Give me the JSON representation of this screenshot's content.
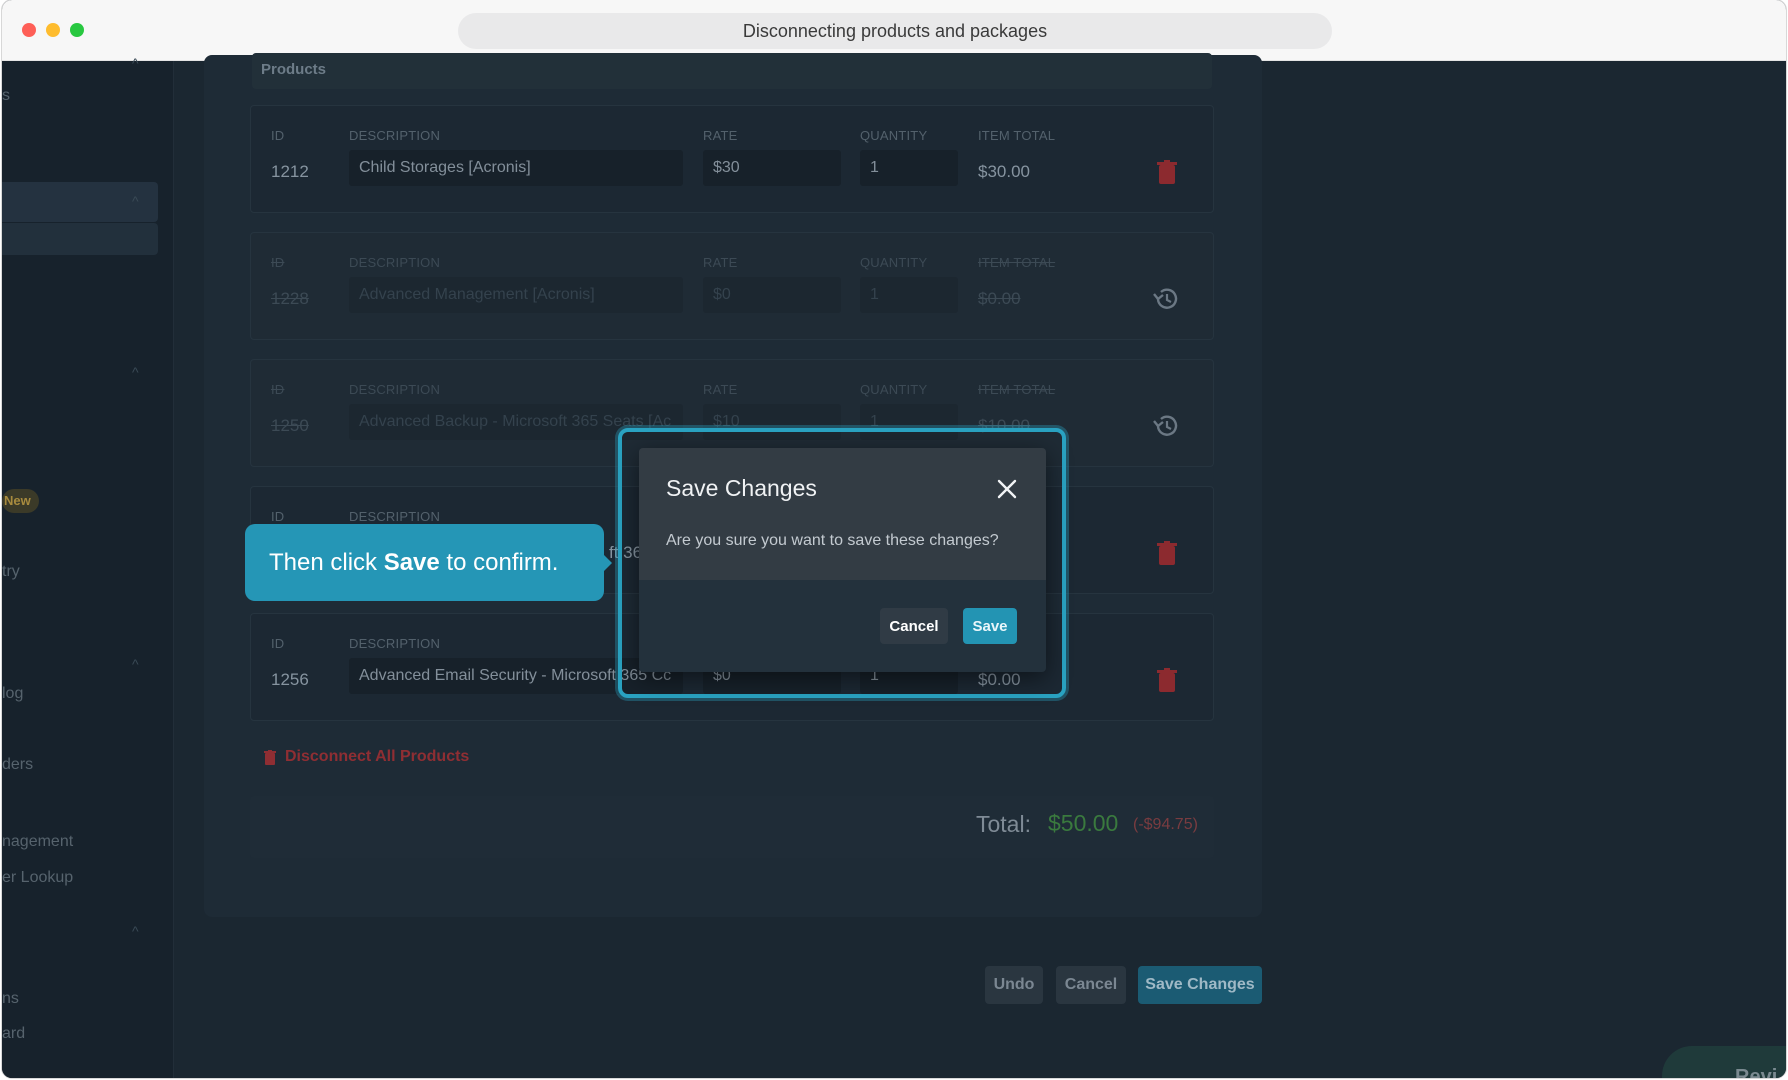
{
  "window": {
    "title": "Disconnecting products and packages"
  },
  "sidebar": {
    "fragments": [
      "s",
      "New",
      "try",
      "log",
      "ders",
      "nagement",
      "er Lookup",
      "ns",
      "ard"
    ]
  },
  "products": {
    "section_title": "Products",
    "columns": {
      "id": "ID",
      "description": "DESCRIPTION",
      "rate": "RATE",
      "quantity": "QUANTITY",
      "item_total": "ITEM TOTAL"
    },
    "rows": [
      {
        "id": "1212",
        "description": "Child Storages [Acronis]",
        "rate": "$30",
        "quantity": "1",
        "item_total": "$30.00",
        "status": "active"
      },
      {
        "id": "1228",
        "description": "Advanced Management [Acronis]",
        "rate": "$0",
        "quantity": "1",
        "item_total": "$0.00",
        "status": "removed"
      },
      {
        "id": "1250",
        "description": "Advanced Backup - Microsoft 365 Seats [Ac",
        "rate": "$10",
        "quantity": "1",
        "item_total": "$10.00",
        "status": "removed"
      },
      {
        "id": "",
        "description": "ft 36",
        "rate": "",
        "quantity": "",
        "item_total": "",
        "status": "active"
      },
      {
        "id": "1256",
        "description": "Advanced Email Security - Microsoft 365 Cc",
        "rate": "$0",
        "quantity": "1",
        "item_total": "$0.00",
        "status": "active"
      }
    ],
    "disconnect_all_label": "Disconnect All Products"
  },
  "totals": {
    "label": "Total:",
    "value": "$50.00",
    "delta": "(-$94.75)"
  },
  "actions": {
    "undo": "Undo",
    "cancel": "Cancel",
    "save_changes": "Save Changes"
  },
  "modal": {
    "title": "Save Changes",
    "message": "Are you sure you want to save these changes?",
    "cancel": "Cancel",
    "save": "Save"
  },
  "tooltip": {
    "prefix": "Then click ",
    "bold": "Save",
    "suffix": " to confirm."
  },
  "widget": {
    "label": "Revi"
  },
  "colors": {
    "accent": "#2596b6",
    "danger": "#c0353c",
    "total": "#3a7a3e"
  }
}
